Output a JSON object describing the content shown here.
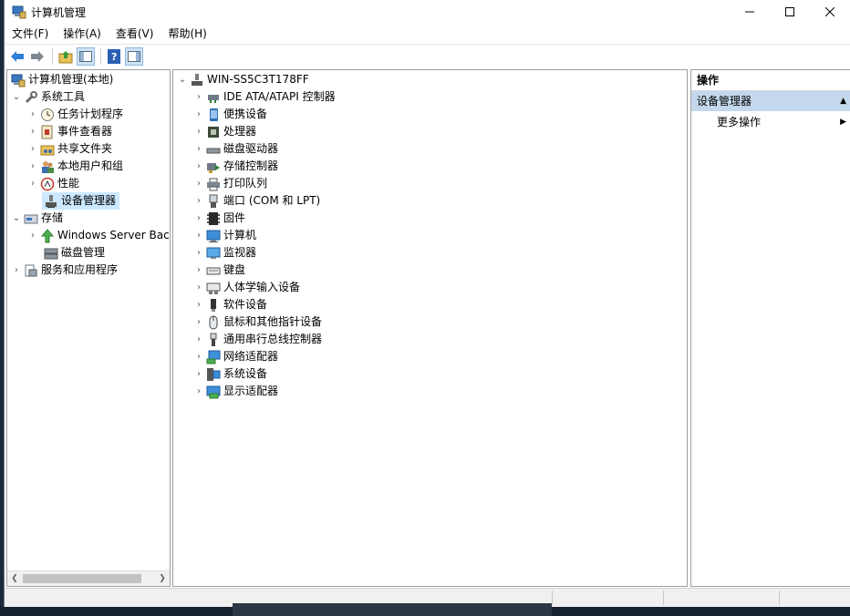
{
  "window": {
    "title": "计算机管理"
  },
  "menu": [
    "文件(F)",
    "操作(A)",
    "查看(V)",
    "帮助(H)"
  ],
  "tree": {
    "root": "计算机管理(本地)",
    "system_tools": "系统工具",
    "task_scheduler": "任务计划程序",
    "event_viewer": "事件查看器",
    "shared_folders": "共享文件夹",
    "local_users": "本地用户和组",
    "performance": "性能",
    "device_manager": "设备管理器",
    "storage": "存储",
    "windows_backup": "Windows Server Back",
    "disk_management": "磁盘管理",
    "services_apps": "服务和应用程序"
  },
  "devices": {
    "computer_name": "WIN-SS5C3T178FF",
    "categories": [
      "IDE ATA/ATAPI 控制器",
      "便携设备",
      "处理器",
      "磁盘驱动器",
      "存储控制器",
      "打印队列",
      "端口 (COM 和 LPT)",
      "固件",
      "计算机",
      "监视器",
      "键盘",
      "人体学输入设备",
      "软件设备",
      "鼠标和其他指针设备",
      "通用串行总线控制器",
      "网络适配器",
      "系统设备",
      "显示适配器"
    ]
  },
  "actions": {
    "header": "操作",
    "section": "设备管理器",
    "more": "更多操作"
  }
}
